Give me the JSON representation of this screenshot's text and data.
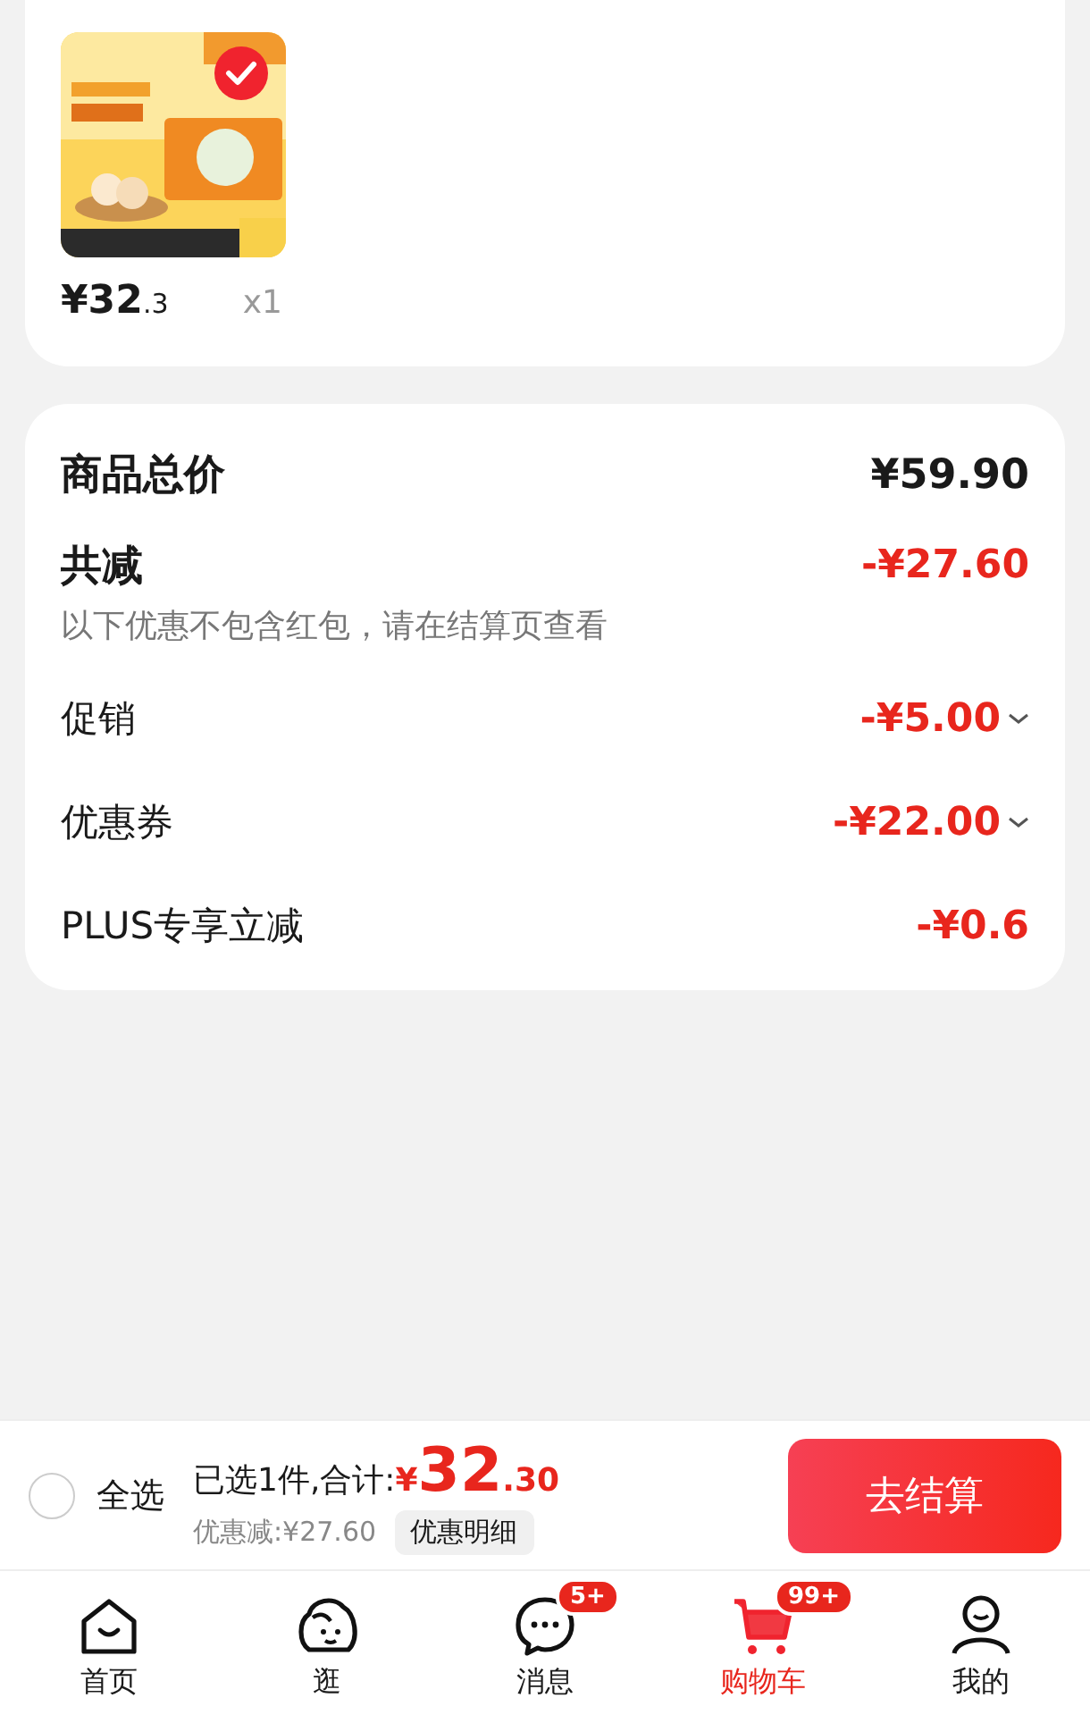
{
  "product": {
    "selected": true,
    "price_main": "¥32",
    "price_decimal": ".3",
    "quantity": "x1"
  },
  "summary": {
    "total": {
      "label": "商品总价",
      "value": "¥59.90"
    },
    "discount": {
      "label": "共减",
      "value": "-¥27.60",
      "note": "以下优惠不包含红包，请在结算页查看"
    },
    "items": [
      {
        "label": "促销",
        "value": "-¥5.00",
        "expandable": true
      },
      {
        "label": "优惠券",
        "value": "-¥22.00",
        "expandable": true
      },
      {
        "label": "PLUS专享立减",
        "value": "-¥0.6",
        "expandable": false
      }
    ]
  },
  "checkout_bar": {
    "select_all": {
      "label": "全选",
      "checked": false
    },
    "selected_text": "已选1件,合计:",
    "currency": "¥",
    "total_main": "32",
    "total_decimal": ".30",
    "discount_text": "优惠减:¥27.60",
    "detail_button": "优惠明细",
    "checkout_button": "去结算"
  },
  "tab_bar": [
    {
      "label": "首页",
      "kind": "home",
      "selected": false
    },
    {
      "label": "逛",
      "kind": "browse",
      "selected": false
    },
    {
      "label": "消息",
      "kind": "message",
      "selected": false,
      "badge": "5+"
    },
    {
      "label": "购物车",
      "kind": "cart",
      "selected": true,
      "badge": "99+"
    },
    {
      "label": "我的",
      "kind": "profile",
      "selected": false
    }
  ]
}
